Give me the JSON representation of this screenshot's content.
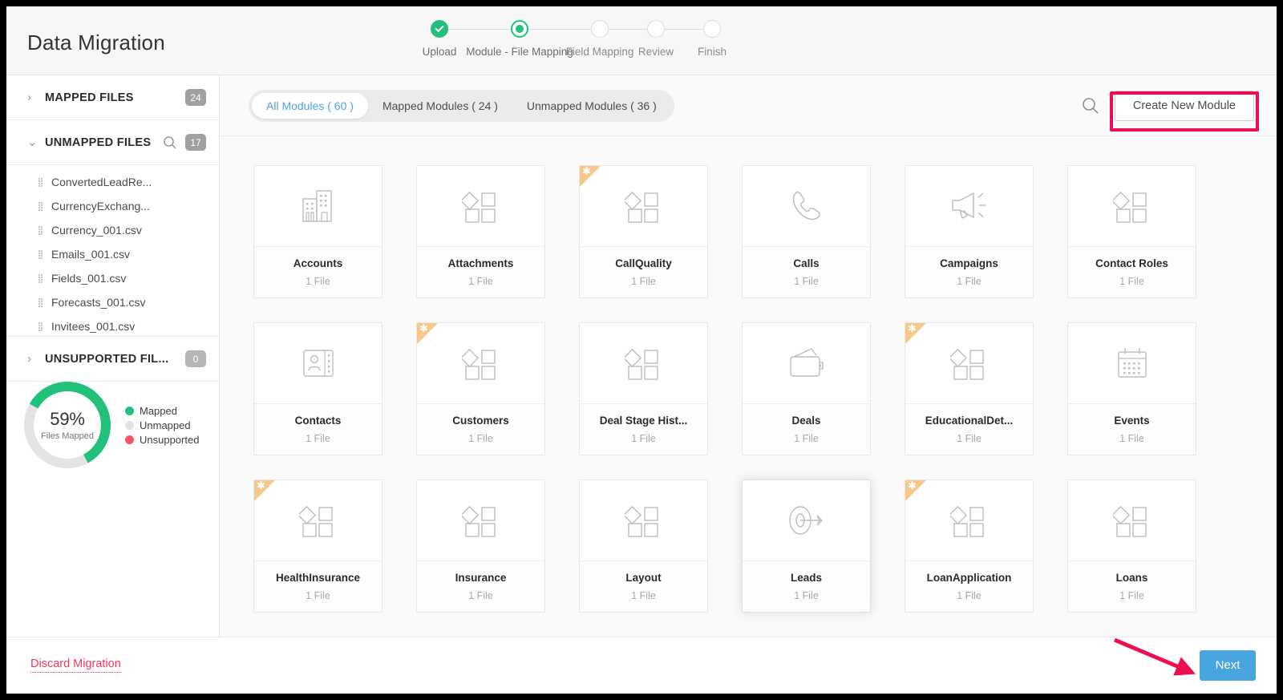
{
  "header": {
    "title": "Data Migration",
    "steps": [
      {
        "label": "Upload",
        "state": "done"
      },
      {
        "label": "Module - File Mapping",
        "state": "active"
      },
      {
        "label": "Field Mapping",
        "state": "todo"
      },
      {
        "label": "Review",
        "state": "todo"
      },
      {
        "label": "Finish",
        "state": "todo"
      }
    ]
  },
  "sidebar": {
    "mapped_files": {
      "label": "MAPPED FILES",
      "count": "24",
      "expanded": false
    },
    "unmapped_files": {
      "label": "UNMAPPED FILES",
      "count": "17",
      "expanded": true
    },
    "unsupported_files": {
      "label": "UNSUPPORTED FIL...",
      "count": "0",
      "expanded": false
    },
    "files": [
      "ConvertedLeadRe...",
      "CurrencyExchang...",
      "Currency_001.csv",
      "Emails_001.csv",
      "Fields_001.csv",
      "Forecasts_001.csv",
      "Invitees_001.csv"
    ],
    "progress": {
      "percent": "59%",
      "percent_value": 59,
      "caption": "Files Mapped",
      "legend": [
        {
          "label": "Mapped",
          "color": "#22c17b"
        },
        {
          "label": "Unmapped",
          "color": "#e2e2e2"
        },
        {
          "label": "Unsupported",
          "color": "#f8536d"
        }
      ]
    }
  },
  "toolbar": {
    "tabs": [
      {
        "label": "All Modules ( 60 )",
        "active": true
      },
      {
        "label": "Mapped Modules ( 24 )",
        "active": false
      },
      {
        "label": "Unmapped Modules ( 36 )",
        "active": false
      }
    ],
    "search_icon": "search-icon",
    "create_button": "Create New Module",
    "highlight_color": "#ec0e50"
  },
  "modules": [
    {
      "name": "Accounts",
      "files": "1 File",
      "icon": "building-icon",
      "custom": false,
      "hover": false
    },
    {
      "name": "Attachments",
      "files": "1 File",
      "icon": "shapes-icon",
      "custom": false,
      "hover": false
    },
    {
      "name": "CallQuality",
      "files": "1 File",
      "icon": "shapes-icon",
      "custom": true,
      "hover": false
    },
    {
      "name": "Calls",
      "files": "1 File",
      "icon": "phone-icon",
      "custom": false,
      "hover": false
    },
    {
      "name": "Campaigns",
      "files": "1 File",
      "icon": "megaphone-icon",
      "custom": false,
      "hover": false
    },
    {
      "name": "Contact Roles",
      "files": "1 File",
      "icon": "shapes-icon",
      "custom": false,
      "hover": false
    },
    {
      "name": "Contacts",
      "files": "1 File",
      "icon": "contact-card-icon",
      "custom": false,
      "hover": false
    },
    {
      "name": "Customers",
      "files": "1 File",
      "icon": "shapes-icon",
      "custom": true,
      "hover": false
    },
    {
      "name": "Deal Stage Hist...",
      "files": "1 File",
      "icon": "shapes-icon",
      "custom": false,
      "hover": false
    },
    {
      "name": "Deals",
      "files": "1 File",
      "icon": "wallet-icon",
      "custom": false,
      "hover": false
    },
    {
      "name": "EducationalDet...",
      "files": "1 File",
      "icon": "shapes-icon",
      "custom": true,
      "hover": false
    },
    {
      "name": "Events",
      "files": "1 File",
      "icon": "calendar-icon",
      "custom": false,
      "hover": false
    },
    {
      "name": "HealthInsurance",
      "files": "1 File",
      "icon": "shapes-icon",
      "custom": true,
      "hover": false
    },
    {
      "name": "Insurance",
      "files": "1 File",
      "icon": "shapes-icon",
      "custom": false,
      "hover": false
    },
    {
      "name": "Layout",
      "files": "1 File",
      "icon": "shapes-icon",
      "custom": false,
      "hover": false
    },
    {
      "name": "Leads",
      "files": "1 File",
      "icon": "target-icon",
      "custom": false,
      "hover": true
    },
    {
      "name": "LoanApplication",
      "files": "1 File",
      "icon": "shapes-icon",
      "custom": true,
      "hover": false
    },
    {
      "name": "Loans",
      "files": "1 File",
      "icon": "shapes-icon",
      "custom": false,
      "hover": false
    }
  ],
  "footer": {
    "discard_label": "Discard Migration",
    "next_label": "Next",
    "annotation_arrow_color": "#ec0e50"
  }
}
